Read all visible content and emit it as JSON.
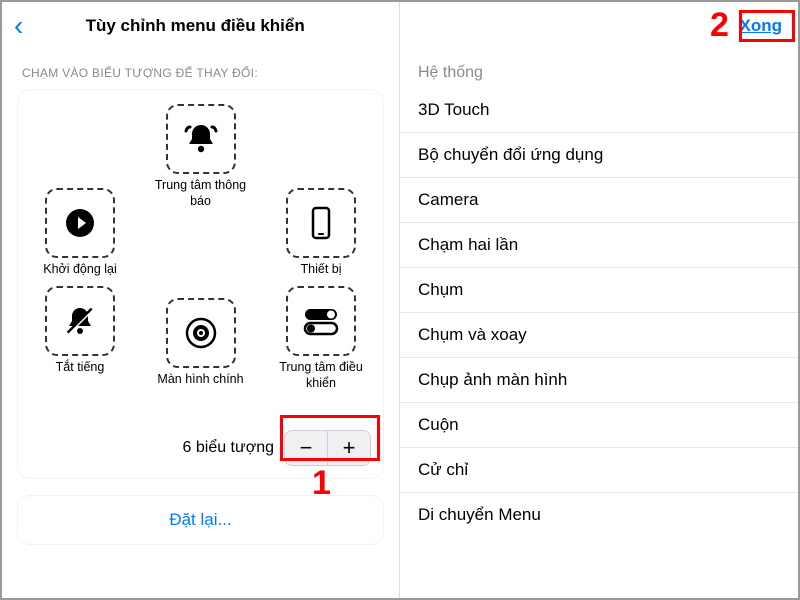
{
  "left": {
    "title": "Tùy chỉnh menu điều khiển",
    "instruction": "CHẠM VÀO BIỂU TƯỢNG ĐỂ THAY ĐỔI:",
    "slots": {
      "top": "Trung tâm thông báo",
      "left": "Khởi động lại",
      "right": "Thiết bị",
      "bl": "Tắt tiếng",
      "bm": "Màn hình chính",
      "br": "Trung tâm điều khiển"
    },
    "count_label": "6 biểu tượng",
    "reset": "Đặt lại..."
  },
  "right": {
    "done": "Xong",
    "section": "Hệ thống",
    "items": [
      "3D Touch",
      "Bộ chuyển đổi ứng dụng",
      "Camera",
      "Chạm hai lần",
      "Chụm",
      "Chụm và xoay",
      "Chụp ảnh màn hình",
      "Cuộn",
      "Cử chỉ",
      "Di chuyển Menu"
    ]
  },
  "ann": {
    "one": "1",
    "two": "2"
  }
}
